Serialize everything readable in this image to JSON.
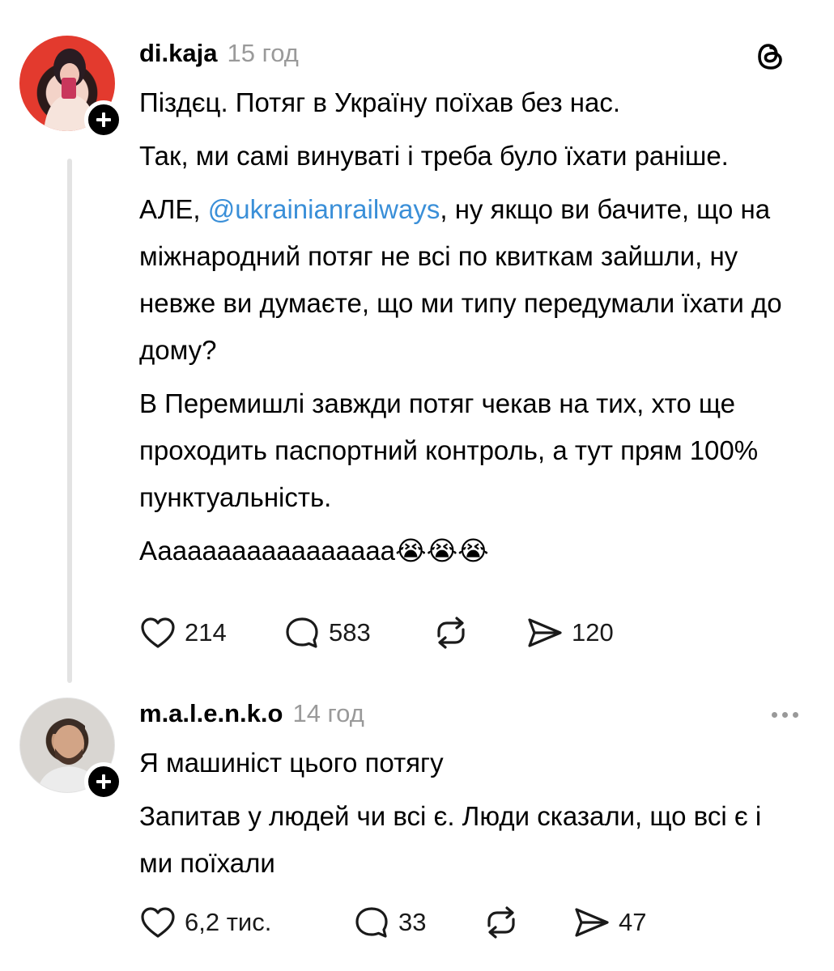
{
  "posts": [
    {
      "username": "di.kaja",
      "time": "15 год",
      "paragraphs": [
        {
          "text": "Піздєц. Потяг в Україну поїхав без нас."
        },
        {
          "text": "Так, ми самі винуваті і треба було їхати раніше."
        },
        {
          "before": "АЛЕ, ",
          "mention": "@ukrainianrailways",
          "after": ", ну якщо ви бачите, що на міжнародний потяг не всі по квиткам зайшли, ну невже ви думаєте, що ми типу передумали їхати до дому?"
        },
        {
          "text": "В Перемишлі завжди потяг чекав на тих, хто ще проходить паспортний контроль, а тут прям 100% пунктуальність."
        },
        {
          "text": "Ааааааааааааааааа😭😭😭"
        }
      ],
      "likes": "214",
      "replies": "583",
      "reposts": "",
      "shares": "120",
      "top_icon": "threads-logo-icon"
    },
    {
      "username": "m.a.l.e.n.k.o",
      "time": "14 год",
      "paragraphs": [
        {
          "text": "Я машиніст цього потягу"
        },
        {
          "text": "Запитав у людей чи всі є. Люди сказали, що всі є і ми поїхали"
        }
      ],
      "likes": "6,2 тис.",
      "replies": "33",
      "reposts": "",
      "shares": "47",
      "top_icon": "more-options-icon"
    }
  ],
  "colors": {
    "mention": "#3a8fd8",
    "time": "#9a9a9a",
    "thread_line": "#e3e3e3"
  }
}
